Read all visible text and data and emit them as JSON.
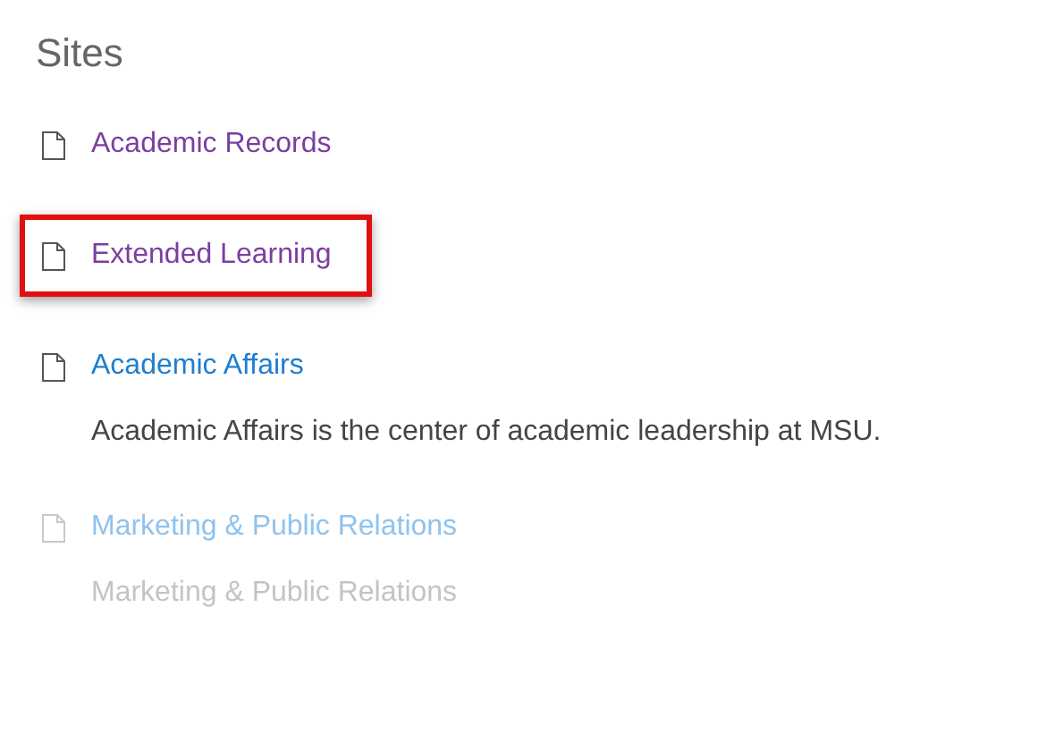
{
  "heading": "Sites",
  "sites": [
    {
      "title": "Academic Records",
      "visited": true,
      "highlighted": false,
      "faded": false
    },
    {
      "title": "Extended Learning",
      "visited": true,
      "highlighted": true,
      "faded": false
    },
    {
      "title": "Academic Affairs",
      "visited": false,
      "highlighted": false,
      "faded": false,
      "description": "Academic Affairs is the center of academic leadership at MSU."
    },
    {
      "title": "Marketing & Public Relations",
      "visited": false,
      "highlighted": false,
      "faded": true,
      "description": "Marketing & Public Relations"
    }
  ]
}
